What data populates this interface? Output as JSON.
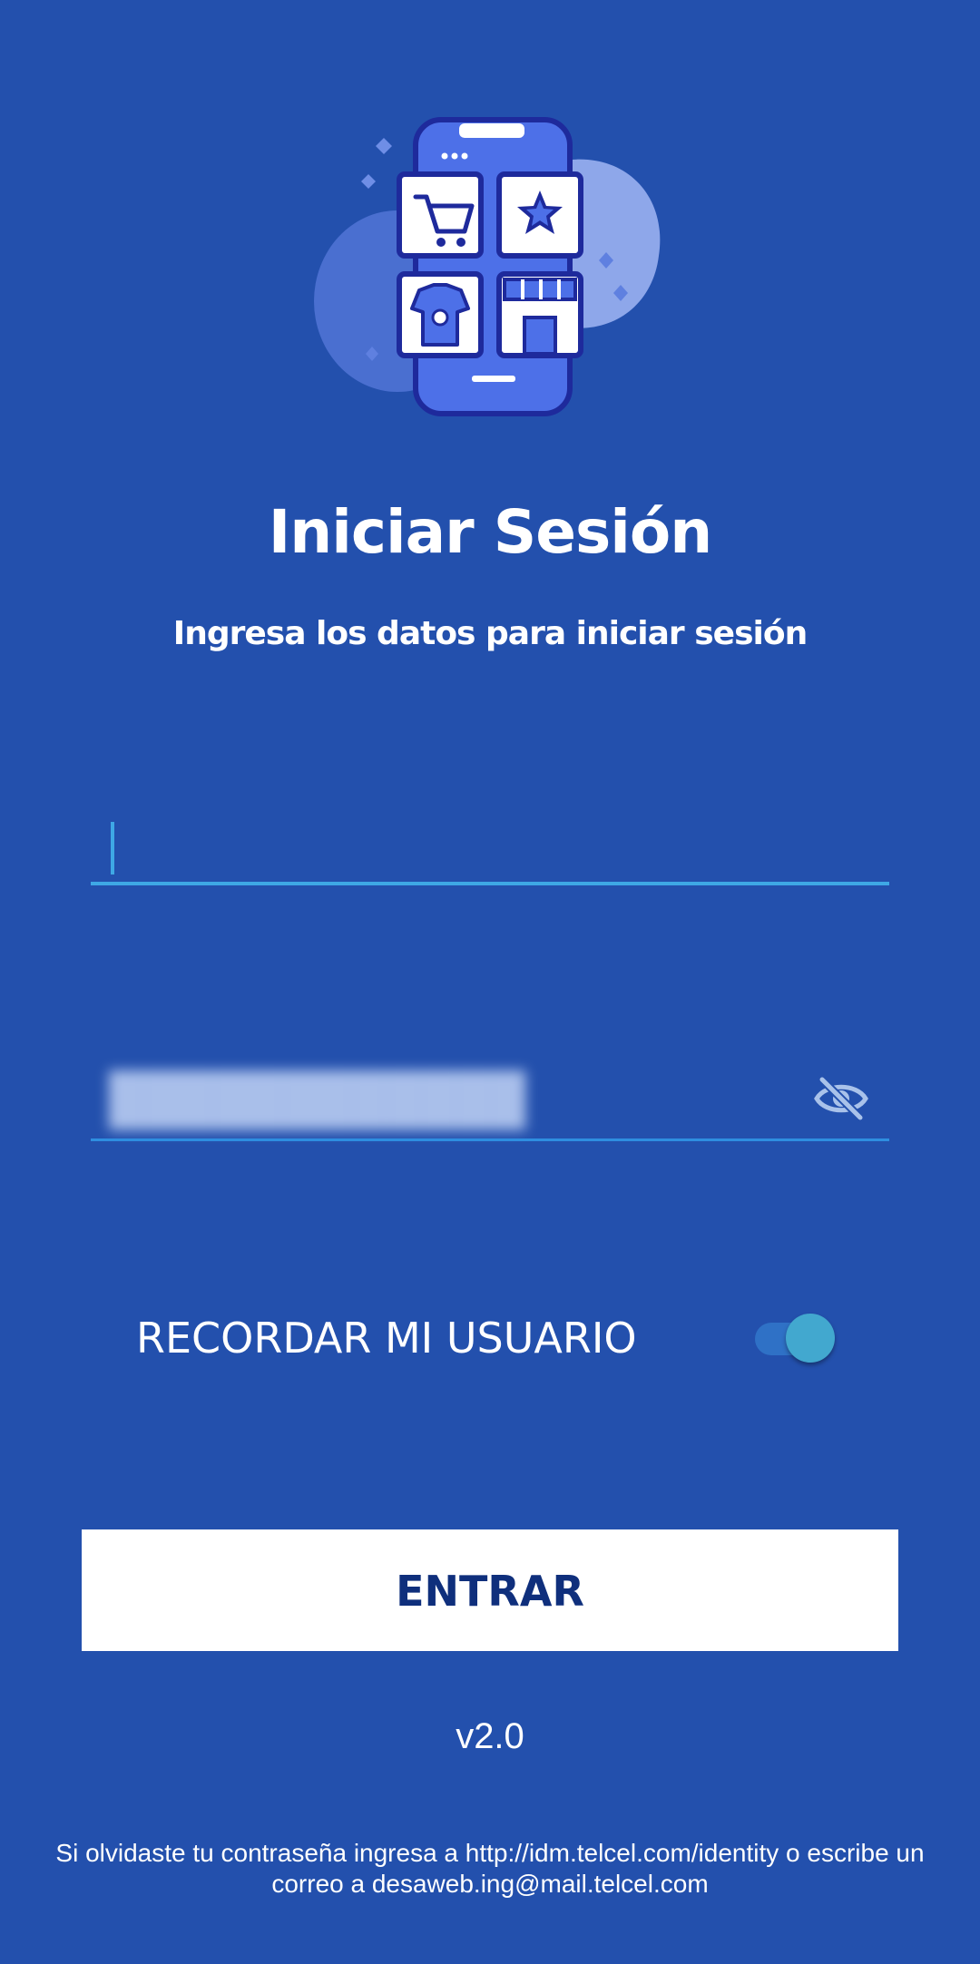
{
  "colors": {
    "background": "#2350ad",
    "accent": "#3ea8e5",
    "button_text": "#0f2f7c",
    "button_bg": "#ffffff"
  },
  "header": {
    "illustration_icon": "mobile-store-illustration",
    "title": "Iniciar Sesión",
    "subtitle": "Ingresa los datos para iniciar sesión"
  },
  "form": {
    "user_field": {
      "value": ""
    },
    "password_field": {
      "value": "",
      "toggle_icon": "eye-off-icon"
    },
    "remember": {
      "label": "RECORDAR MI USUARIO",
      "enabled": true
    },
    "submit_label": "ENTRAR"
  },
  "version": "v2.0",
  "footer": {
    "line1": "Si olvidaste tu contraseña ingresa a http://idm.telcel.com/identity o escribe un",
    "line2": "correo a desaweb.ing@mail.telcel.com"
  }
}
